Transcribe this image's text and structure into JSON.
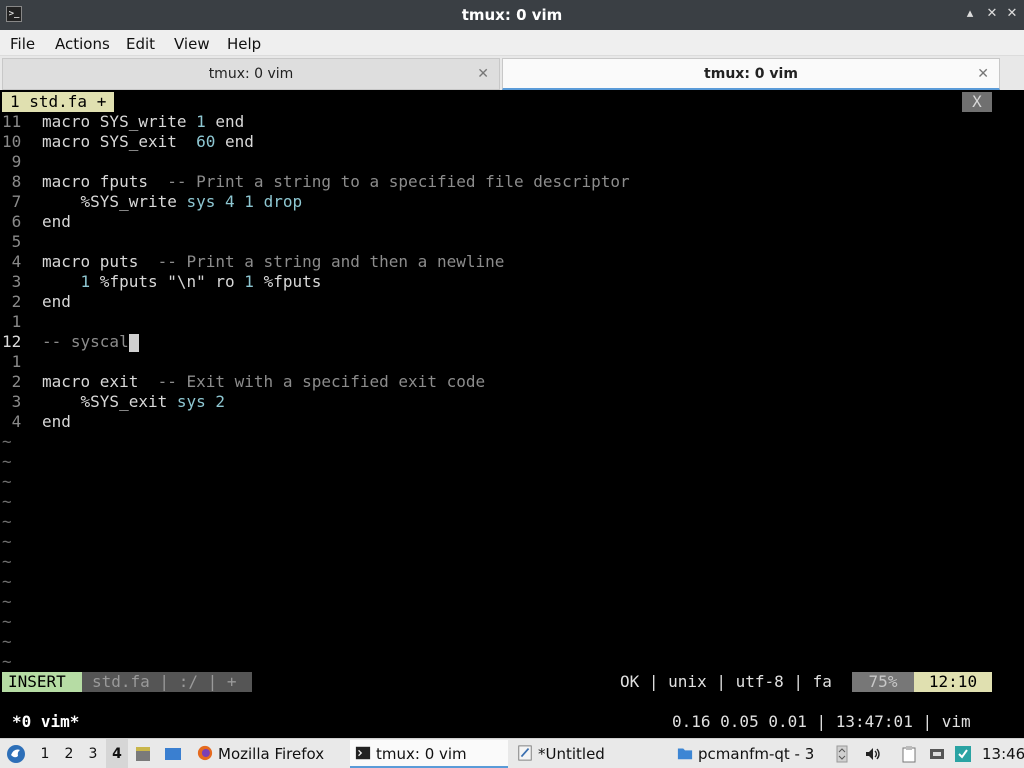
{
  "window": {
    "title": "tmux: 0 vim",
    "controls": [
      "▴",
      "✕",
      "✕"
    ]
  },
  "menu": [
    "File",
    "Actions",
    "Edit",
    "View",
    "Help"
  ],
  "tabs": [
    {
      "label": "tmux: 0 vim",
      "active": false
    },
    {
      "label": "tmux: 0 vim",
      "active": true
    }
  ],
  "vim": {
    "buffer_tab": "1 std.fa +",
    "buffer_close": "X",
    "lines": [
      {
        "n": "11",
        "code": [
          [
            "kw",
            "macro SYS_write "
          ],
          [
            "num",
            "1"
          ],
          [
            "kw",
            " end"
          ]
        ]
      },
      {
        "n": "10",
        "code": [
          [
            "kw",
            "macro SYS_exit  "
          ],
          [
            "num",
            "60"
          ],
          [
            "kw",
            " end"
          ]
        ]
      },
      {
        "n": " 9",
        "code": []
      },
      {
        "n": " 8",
        "code": [
          [
            "kw",
            "macro fputs  "
          ],
          [
            "cm",
            "-- Print a string to a specified file descriptor"
          ]
        ]
      },
      {
        "n": " 7",
        "code": [
          [
            "kw",
            "    %SYS_write "
          ],
          [
            "num",
            "sys 4 1 drop"
          ]
        ]
      },
      {
        "n": " 6",
        "code": [
          [
            "kw",
            "end"
          ]
        ]
      },
      {
        "n": " 5",
        "code": []
      },
      {
        "n": " 4",
        "code": [
          [
            "kw",
            "macro puts  "
          ],
          [
            "cm",
            "-- Print a string and then a newline"
          ]
        ]
      },
      {
        "n": " 3",
        "code": [
          [
            "kw",
            "    "
          ],
          [
            "num",
            "1"
          ],
          [
            "kw",
            " %fputs "
          ],
          [
            "str",
            "\"\\n\""
          ],
          [
            "kw",
            " ro "
          ],
          [
            "num",
            "1"
          ],
          [
            "kw",
            " %fputs"
          ]
        ]
      },
      {
        "n": " 2",
        "code": [
          [
            "kw",
            "end"
          ]
        ]
      },
      {
        "n": " 1",
        "code": []
      },
      {
        "n": "12",
        "current": true,
        "code": [
          [
            "cm",
            "-- syscal"
          ]
        ]
      },
      {
        "n": " 1",
        "code": []
      },
      {
        "n": " 2",
        "code": [
          [
            "kw",
            "macro exit  "
          ],
          [
            "cm",
            "-- Exit with a specified exit code"
          ]
        ]
      },
      {
        "n": " 3",
        "code": [
          [
            "kw",
            "    %SYS_exit "
          ],
          [
            "num",
            "sys 2"
          ]
        ]
      },
      {
        "n": " 4",
        "code": [
          [
            "kw",
            "end"
          ]
        ]
      }
    ],
    "tilde": "~",
    "status": {
      "mode": "INSERT",
      "file": "std.fa  |  :/  |  +",
      "info": "OK  |  unix  |  utf-8  |  fa",
      "percent": "75%",
      "position": "12:10"
    }
  },
  "tmux": {
    "window": "*0 vim*",
    "status": "0.16 0.05 0.01 | 13:47:01 | vim"
  },
  "taskbar": {
    "desktops": [
      "1",
      "2",
      "3",
      "4"
    ],
    "active_desktop": "4",
    "tasks": [
      {
        "label": "Mozilla Firefox",
        "icon": "firefox-icon"
      },
      {
        "label": "tmux: 0 vim",
        "icon": "terminal-icon",
        "active": true
      },
      {
        "label": "*Untitled",
        "icon": "text-editor-icon"
      },
      {
        "label": "pcmanfm-qt - 3 ...",
        "icon": "folder-icon"
      }
    ],
    "clock": "13:46"
  }
}
